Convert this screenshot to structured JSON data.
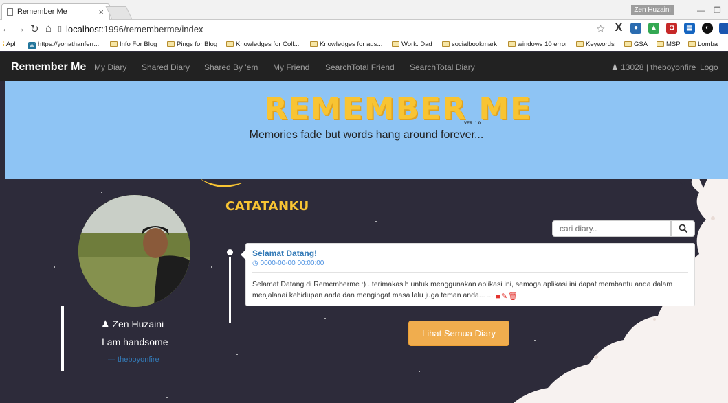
{
  "browser": {
    "tab_title": "Remember Me",
    "tab_close": "×",
    "profile_chip": "Zen Huzaini",
    "url_host": "localhost",
    "url_path": ":1996/rememberme/index",
    "bookmarks": [
      {
        "label": "Apl",
        "type": "app"
      },
      {
        "label": "https://yonathanferr...",
        "type": "wp"
      },
      {
        "label": "Info For Blog",
        "type": "folder"
      },
      {
        "label": "Pings for Blog",
        "type": "folder"
      },
      {
        "label": "Knowledges for Coll...",
        "type": "folder"
      },
      {
        "label": "Knowledges for ads...",
        "type": "folder"
      },
      {
        "label": "Work. Dad",
        "type": "folder"
      },
      {
        "label": "socialbookmark",
        "type": "folder"
      },
      {
        "label": "windows 10 error",
        "type": "folder"
      },
      {
        "label": "Keywords",
        "type": "folder"
      },
      {
        "label": "GSA",
        "type": "folder"
      },
      {
        "label": "MSP",
        "type": "folder"
      },
      {
        "label": "Lomba",
        "type": "folder"
      }
    ]
  },
  "navbar": {
    "brand": "Remember Me",
    "items": [
      "My Diary",
      "Shared Diary",
      "Shared By 'em",
      "My Friend",
      "SearchTotal Friend",
      "SearchTotal Diary"
    ],
    "user": "13028 | theboyonfire",
    "logout": "Logo"
  },
  "header": {
    "logo": "REMEMBER ME",
    "version": "VER. 1.0",
    "tagline": "Memories fade but words hang around forever..."
  },
  "section": {
    "title": "CATATANKU"
  },
  "profile": {
    "name": "Zen Huzaini",
    "bio": "I am handsome",
    "handle": "— theboyonfire"
  },
  "search": {
    "placeholder": "cari diary.."
  },
  "diary": {
    "title": "Selamat Datang!",
    "date": "0000-00-00 00:00:00",
    "body": "Selamat Datang di Rememberme :) . terimakasih untuk menggunakan aplikasi ini, semoga aplikasi ini dapat membantu anda dalam menjalanai kehidupan anda dan mengingat masa lalu juga teman anda... ..."
  },
  "actions": {
    "view_all": "Lihat Semua Diary"
  },
  "colors": {
    "navbar": "#222222",
    "header": "#8ec4f4",
    "background": "#2d2b3a",
    "accent": "#f8c433",
    "button": "#f0ad4e",
    "link": "#337ab7"
  }
}
